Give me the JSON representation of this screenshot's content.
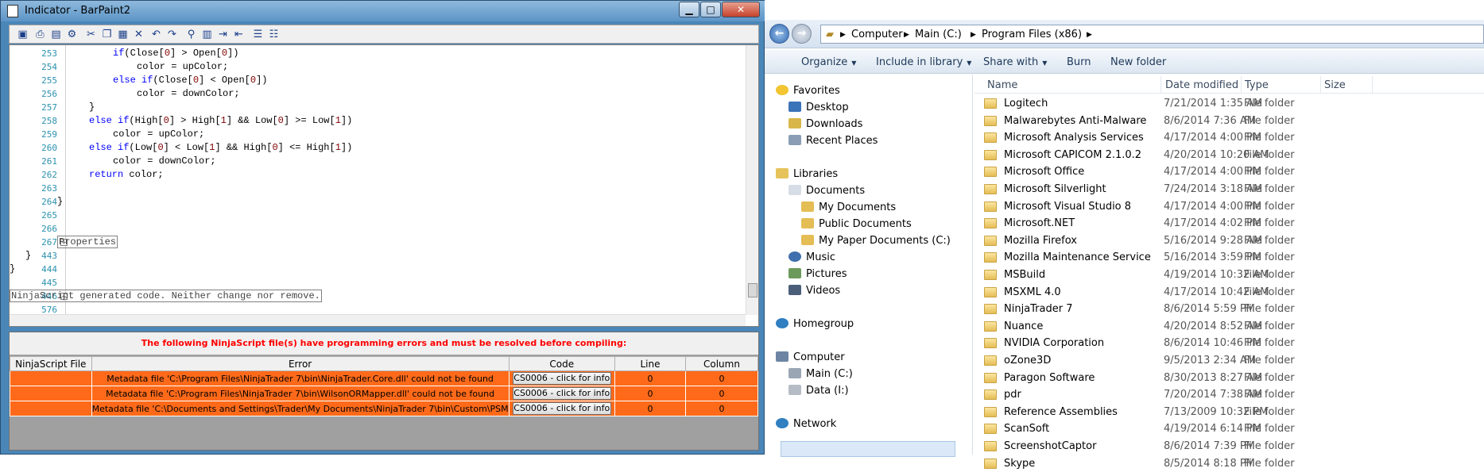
{
  "ide": {
    "title": "Indicator - BarPaint2",
    "min_glyph": "▁",
    "max_glyph": "□",
    "close_glyph": "✕",
    "lines": [
      {
        "num": "253",
        "indent": 1,
        "parts": [
          [
            "kw",
            "if"
          ],
          [
            "",
            "(Close["
          ],
          [
            "num",
            "0"
          ],
          [
            "",
            "] > Open["
          ],
          [
            "num",
            "0"
          ],
          [
            "",
            "])"
          ]
        ]
      },
      {
        "num": "254",
        "indent": 2,
        "parts": [
          [
            "",
            "color = upColor;"
          ]
        ]
      },
      {
        "num": "255",
        "indent": 1,
        "parts": [
          [
            "kw",
            "else if"
          ],
          [
            "",
            "(Close["
          ],
          [
            "num",
            "0"
          ],
          [
            "",
            "] < Open["
          ],
          [
            "num",
            "0"
          ],
          [
            "",
            "])"
          ]
        ]
      },
      {
        "num": "256",
        "indent": 2,
        "parts": [
          [
            "",
            "color = downColor;"
          ]
        ]
      },
      {
        "num": "257",
        "indent": 0,
        "parts": [
          [
            "",
            "}"
          ]
        ]
      },
      {
        "num": "258",
        "indent": 0,
        "parts": [
          [
            "kw",
            "else if"
          ],
          [
            "",
            "(High["
          ],
          [
            "num",
            "0"
          ],
          [
            "",
            "] > High["
          ],
          [
            "num",
            "1"
          ],
          [
            "",
            "] && Low["
          ],
          [
            "num",
            "0"
          ],
          [
            "",
            "] >= Low["
          ],
          [
            "num",
            "1"
          ],
          [
            "",
            "])"
          ]
        ]
      },
      {
        "num": "259",
        "indent": 1,
        "parts": [
          [
            "",
            "color = upColor;"
          ]
        ]
      },
      {
        "num": "260",
        "indent": 0,
        "parts": [
          [
            "kw",
            "else if"
          ],
          [
            "",
            "(Low["
          ],
          [
            "num",
            "0"
          ],
          [
            "",
            "] < Low["
          ],
          [
            "num",
            "1"
          ],
          [
            "",
            "] && High["
          ],
          [
            "num",
            "0"
          ],
          [
            "",
            "] <= High["
          ],
          [
            "num",
            "1"
          ],
          [
            "",
            "])"
          ]
        ]
      },
      {
        "num": "261",
        "indent": 1,
        "parts": [
          [
            "",
            "color = downColor;"
          ]
        ]
      },
      {
        "num": "262",
        "indent": 0,
        "parts": [
          [
            "kw",
            "return"
          ],
          [
            "",
            " color;"
          ]
        ]
      },
      {
        "num": "263",
        "indent": 0,
        "parts": []
      },
      {
        "num": "264",
        "indent": -1,
        "parts": [
          [
            "",
            "}"
          ]
        ]
      },
      {
        "num": "265",
        "indent": 0,
        "parts": []
      },
      {
        "num": "266",
        "indent": 0,
        "parts": []
      },
      {
        "num": "267",
        "indent": -1,
        "parts": [
          [
            "box",
            "Properties"
          ]
        ]
      },
      {
        "num": "443",
        "indent": -2,
        "parts": [
          [
            "",
            "}"
          ]
        ]
      },
      {
        "num": "444",
        "indent": -3,
        "parts": [
          [
            "",
            "}"
          ]
        ]
      },
      {
        "num": "445",
        "indent": 0,
        "parts": []
      },
      {
        "num": "446",
        "indent": -4,
        "parts": [
          [
            "box",
            "NinjaScript generated code. Neither change nor remove."
          ]
        ]
      },
      {
        "num": "576",
        "indent": 0,
        "parts": []
      }
    ],
    "error_message": "The following NinjaScript file(s) have programming errors and must be resolved before compiling:",
    "columns": [
      "NinjaScript File",
      "Error",
      "Code",
      "Line",
      "Column"
    ],
    "errors": [
      {
        "file": "",
        "error": "Metadata file 'C:\\Program Files\\NinjaTrader 7\\bin\\NinjaTrader.Core.dll' could not be found",
        "code": "CS0006 - click for info",
        "line": "0",
        "column": "0"
      },
      {
        "file": "",
        "error": "Metadata file 'C:\\Program Files\\NinjaTrader 7\\bin\\WilsonORMapper.dll' could not be found",
        "code": "CS0006 - click for info",
        "line": "0",
        "column": "0"
      },
      {
        "file": "",
        "error": "Metadata file 'C:\\Documents and Settings\\Trader\\My Documents\\NinjaTrader 7\\bin\\Custom\\PSM",
        "code": "CS0006 - click for info",
        "line": "0",
        "column": "0"
      }
    ]
  },
  "explorer": {
    "breadcrumb": [
      "Computer",
      "Main (C:)",
      "Program Files (x86)"
    ],
    "commands": [
      "Organize",
      "Include in library",
      "Share with",
      "Burn",
      "New folder"
    ],
    "columns": [
      "Name",
      "Date modified",
      "Type",
      "Size"
    ],
    "nav": {
      "favorites": "Favorites",
      "desktop": "Desktop",
      "downloads": "Downloads",
      "recent": "Recent Places",
      "libraries": "Libraries",
      "documents": "Documents",
      "my_documents": "My Documents",
      "public_documents": "Public Documents",
      "my_paper_documents": "My Paper Documents (C:)",
      "music": "Music",
      "pictures": "Pictures",
      "videos": "Videos",
      "homegroup": "Homegroup",
      "computer": "Computer",
      "main_c": "Main (C:)",
      "data_i": "Data (I:)",
      "network": "Network"
    },
    "files": [
      {
        "name": "Logitech",
        "date": "7/21/2014 1:35 AM",
        "type": "File folder"
      },
      {
        "name": "Malwarebytes Anti-Malware",
        "date": "8/6/2014 7:36 AM",
        "type": "File folder"
      },
      {
        "name": "Microsoft Analysis Services",
        "date": "4/17/2014 4:00 PM",
        "type": "File folder"
      },
      {
        "name": "Microsoft CAPICOM 2.1.0.2",
        "date": "4/20/2014 10:20 AM",
        "type": "File folder"
      },
      {
        "name": "Microsoft Office",
        "date": "4/17/2014 4:00 PM",
        "type": "File folder"
      },
      {
        "name": "Microsoft Silverlight",
        "date": "7/24/2014 3:18 AM",
        "type": "File folder"
      },
      {
        "name": "Microsoft Visual Studio 8",
        "date": "4/17/2014 4:00 PM",
        "type": "File folder"
      },
      {
        "name": "Microsoft.NET",
        "date": "4/17/2014 4:02 PM",
        "type": "File folder"
      },
      {
        "name": "Mozilla Firefox",
        "date": "5/16/2014 9:28 AM",
        "type": "File folder"
      },
      {
        "name": "Mozilla Maintenance Service",
        "date": "5/16/2014 3:59 PM",
        "type": "File folder"
      },
      {
        "name": "MSBuild",
        "date": "4/19/2014 10:32 AM",
        "type": "File folder"
      },
      {
        "name": "MSXML 4.0",
        "date": "4/17/2014 10:42 AM",
        "type": "File folder"
      },
      {
        "name": "NinjaTrader 7",
        "date": "8/6/2014 5:59 PM",
        "type": "File folder"
      },
      {
        "name": "Nuance",
        "date": "4/20/2014 8:52 AM",
        "type": "File folder"
      },
      {
        "name": "NVIDIA Corporation",
        "date": "8/6/2014 10:46 PM",
        "type": "File folder"
      },
      {
        "name": "oZone3D",
        "date": "9/5/2013 2:34 AM",
        "type": "File folder"
      },
      {
        "name": "Paragon Software",
        "date": "8/30/2013 8:27 AM",
        "type": "File folder"
      },
      {
        "name": "pdr",
        "date": "7/20/2014 7:38 AM",
        "type": "File folder"
      },
      {
        "name": "Reference Assemblies",
        "date": "7/13/2009 10:32 PM",
        "type": "File folder"
      },
      {
        "name": "ScanSoft",
        "date": "4/19/2014 6:14 PM",
        "type": "File folder"
      },
      {
        "name": "ScreenshotCaptor",
        "date": "8/6/2014 7:39 PM",
        "type": "File folder"
      },
      {
        "name": "Skype",
        "date": "8/5/2014 8:18 PM",
        "type": "File folder"
      }
    ]
  }
}
